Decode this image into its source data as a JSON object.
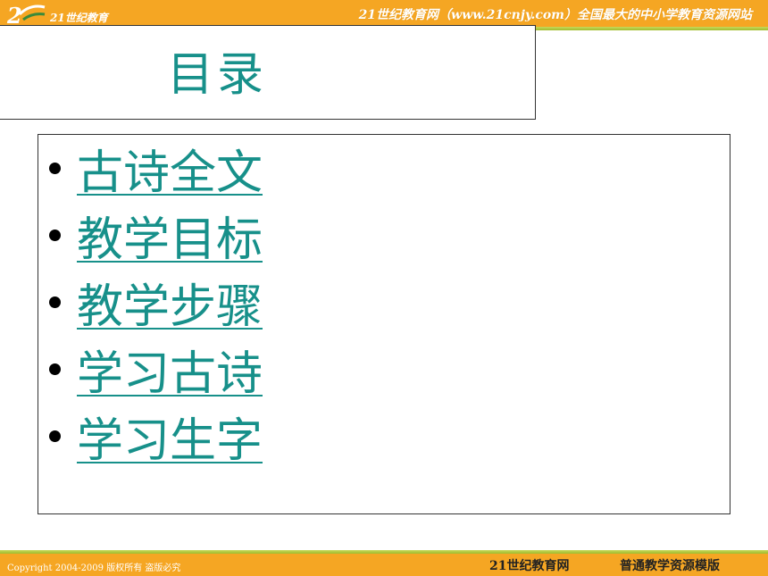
{
  "header": {
    "logo_text": "21世纪教育",
    "slogan": "21世纪教育网（www.21cnjy.com）全国最大的中小学教育资源网站"
  },
  "title": "目录",
  "menu": {
    "items": [
      {
        "label": "古诗全文"
      },
      {
        "label": "教学目标"
      },
      {
        "label": "教学步骤"
      },
      {
        "label": "学习古诗"
      },
      {
        "label": "学习生字"
      }
    ]
  },
  "footer": {
    "copyright": "Copyright 2004-2009 版权所有 盗版必究",
    "brand": "21世纪教育网",
    "template": "普通教学资源模版"
  },
  "colors": {
    "banner": "#f5a623",
    "accent_green": "#9fbc2d",
    "text_teal": "#17908a"
  }
}
